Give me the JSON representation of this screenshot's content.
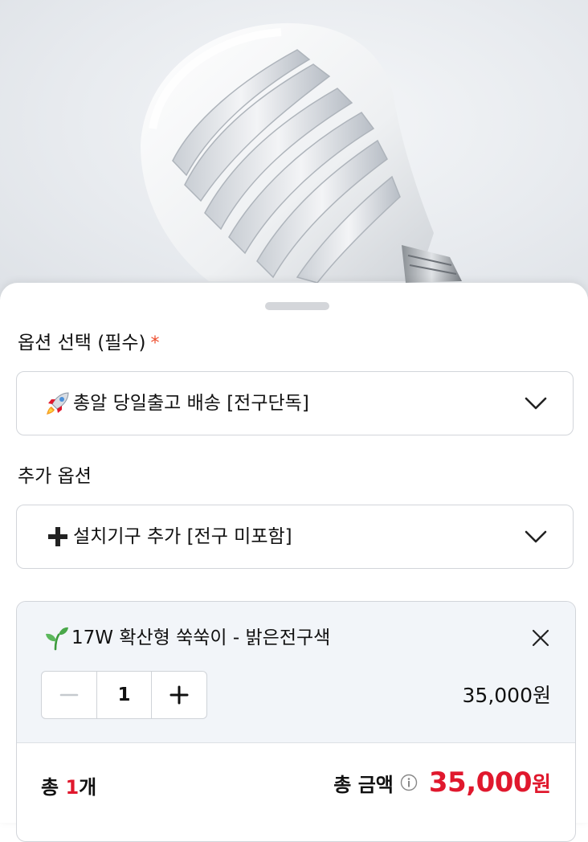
{
  "option_section": {
    "label": "옵션 선택 (필수)",
    "required_mark": "*",
    "selected_text": "총알 당일출고 배송 [전구단독]",
    "icon": "rocket-icon"
  },
  "addon_section": {
    "label": "추가 옵션",
    "selected_text": "설치기구 추가 [전구 미포함]",
    "icon": "plus-icon"
  },
  "selected_item": {
    "icon": "seedling-icon",
    "title": "17W 확산형 쑥쑥이 - 밝은전구색",
    "quantity": "1",
    "price": "35,000원"
  },
  "total": {
    "prefix": "총 ",
    "count": "1",
    "suffix": "개",
    "label": "총 금액",
    "amount": "35,000",
    "unit": "원"
  },
  "colors": {
    "accent_red": "#e0182d",
    "required_orange": "#ee4d2d",
    "card_bg": "#f2f5f9"
  }
}
